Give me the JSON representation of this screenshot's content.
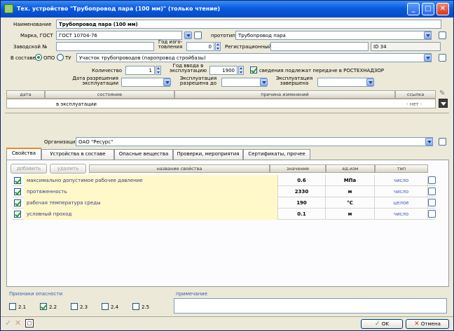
{
  "window": {
    "title": "Тех. устройство \"Трубопровод пара (100 мм)\" (только чтение)",
    "min_symbol": "_",
    "max_symbol": "□",
    "close_symbol": "✕"
  },
  "form": {
    "name_label": "Наименование",
    "name_value": "Трубопровод пара (100 мм)",
    "mark_label": "Марка, ГОСТ",
    "mark_value": "ГОСТ 10704-76",
    "prototype_label": "прототип",
    "prototype_value": "Трубопровод пара",
    "serial_label": "Заводской №",
    "serial_value": "",
    "year_made_label": "Год изго-товления",
    "year_made_value": "0",
    "reg_label": "Регистрационный №",
    "reg_value": "",
    "id_label": "ID 34",
    "composition_label": "В составе",
    "opo_label": "ОПО",
    "tu_label": "ТУ",
    "composition_value": "Участок трубопроводов (паропровод стройбазы)",
    "qty_label": "Количество",
    "qty_value": "1",
    "year_in_label": "Год ввода в эксплуатацию",
    "year_in_value": "1900",
    "rostech_label": "сведения подлежат передаче в РОСТЕХНАДЗОР",
    "permit_label": "Дата разрешения эксплуатации",
    "permit_until_label": "Эксплуатация разрешена до",
    "exploit_done_label": "Эксплуатация завершена"
  },
  "state_table": {
    "headers": [
      "дата",
      "состояние",
      "причина изменений",
      "ссылка"
    ],
    "row": {
      "date": "",
      "state": "в эксплуатации",
      "reason": "",
      "link": "- нет -"
    }
  },
  "org": {
    "label": "Организация",
    "value": "ОАО \"Ресурс\""
  },
  "tabs": [
    "Свойства",
    "Устройства в составе",
    "Опасные вещества",
    "Проверки, мероприятия",
    "Сертификаты, прочее"
  ],
  "props": {
    "add_label": "добавить",
    "delete_label": "удалить",
    "headers": [
      "название свойства",
      "значение",
      "ед.изм",
      "тип"
    ],
    "rows": [
      {
        "name": "максимально допустимое рабочее давление",
        "value": "0.6",
        "unit": "МПа",
        "type": "число"
      },
      {
        "name": "протяженность",
        "value": "2330",
        "unit": "м",
        "type": "число"
      },
      {
        "name": "рабочая температура среды",
        "value": "190",
        "unit": "°С",
        "type": "целое"
      },
      {
        "name": "условный проход",
        "value": "0.1",
        "unit": "м",
        "type": "число"
      }
    ]
  },
  "hazard": {
    "label": "Признаки опасности",
    "note_label": "примечание",
    "items": [
      "2.1",
      "2.2",
      "2.3",
      "2.4",
      "2.5"
    ],
    "checked": [
      false,
      true,
      false,
      false,
      false
    ]
  },
  "footer": {
    "ok_label": "OK",
    "cancel_label": "Отмена"
  },
  "colors": {
    "title_bar": "#0a5be0",
    "prop_row": "#fff8c8",
    "tab_accent": "#e68b2c"
  }
}
